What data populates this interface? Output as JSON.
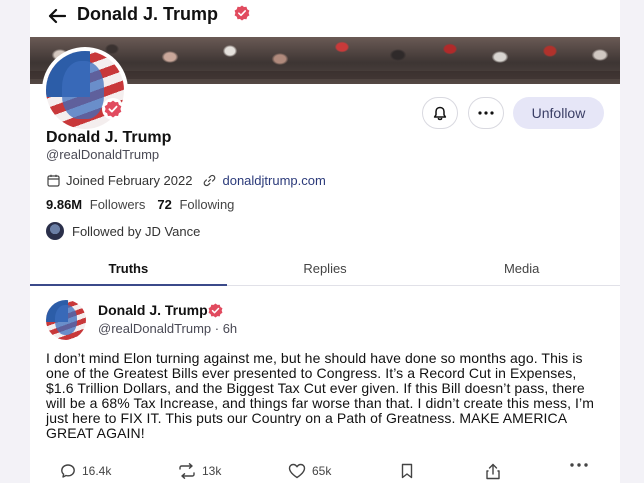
{
  "nav": {
    "title": "Donald J. Trump"
  },
  "profile": {
    "name": "Donald J. Trump",
    "handle": "@realDonaldTrump",
    "joined": "Joined February 2022",
    "website": "donaldjtrump.com",
    "followers_count": "9.86M",
    "followers_label": "Followers",
    "following_count": "72",
    "following_label": "Following",
    "followed_by": "Followed by JD Vance",
    "unfollow_label": "Unfollow"
  },
  "tabs": [
    {
      "label": "Truths",
      "active": true
    },
    {
      "label": "Replies",
      "active": false
    },
    {
      "label": "Media",
      "active": false
    }
  ],
  "post": {
    "author": "Donald J. Trump",
    "handle_time": "@realDonaldTrump · 6h",
    "body": "I don’t mind Elon turning against me, but he should have done so months ago. This is one of the Greatest Bills ever presented to Congress. It’s a Record Cut in Expenses, $1.6 Trillion Dollars, and the Biggest Tax Cut ever given. If this Bill doesn’t pass, there will be a 68% Tax Increase, and things far worse than that. I didn’t create this mess, I’m just here to FIX IT. This puts our Country on a Path of Greatness. MAKE AMERICA GREAT AGAIN!",
    "replies": "16.4k",
    "retruths": "13k",
    "likes": "65k"
  },
  "colors": {
    "verified": "#e14b5f",
    "accent": "#3b4a8a",
    "unfollow_bg": "#e6e6f7"
  },
  "icons": [
    "back-arrow-icon",
    "verified-badge-icon",
    "bell-icon",
    "more-icon",
    "calendar-icon",
    "link-icon",
    "reply-icon",
    "retruth-icon",
    "like-icon",
    "bookmark-icon",
    "share-icon",
    "post-more-icon"
  ]
}
